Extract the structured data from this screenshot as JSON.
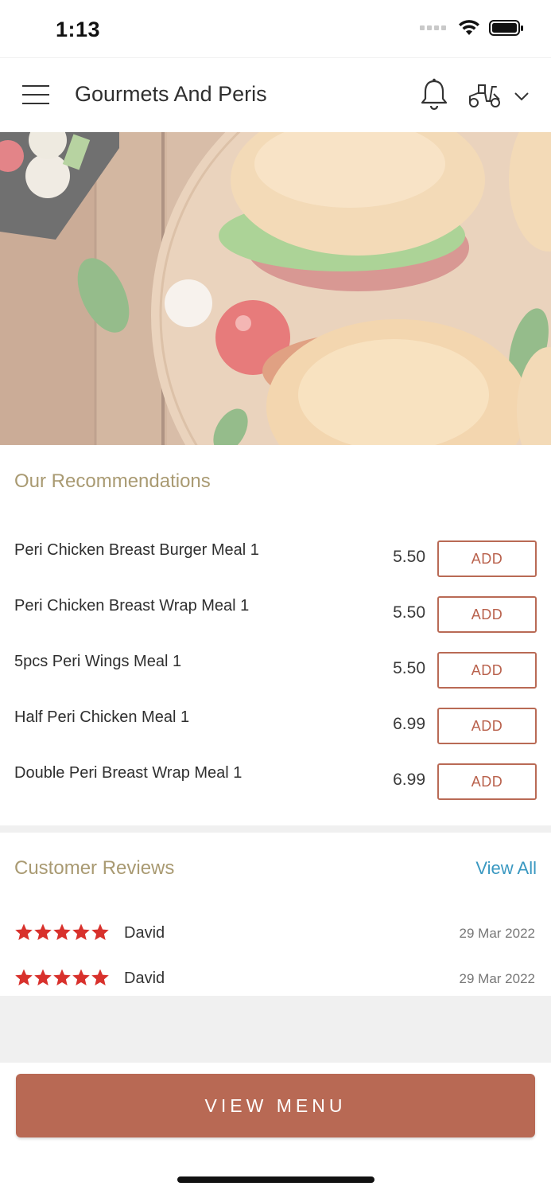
{
  "status_bar": {
    "time": "1:13"
  },
  "header": {
    "title": "Gourmets And Peris"
  },
  "recommendations": {
    "title": "Our Recommendations",
    "items": [
      {
        "name": "Peri Chicken Breast Burger Meal 1",
        "price": "5.50",
        "button": "ADD"
      },
      {
        "name": "Peri Chicken Breast Wrap Meal 1",
        "price": "5.50",
        "button": "ADD"
      },
      {
        "name": "5pcs Peri Wings Meal 1",
        "price": "5.50",
        "button": "ADD"
      },
      {
        "name": "Half Peri Chicken Meal 1",
        "price": "6.99",
        "button": "ADD"
      },
      {
        "name": "Double Peri Breast Wrap Meal 1",
        "price": "6.99",
        "button": "ADD"
      }
    ]
  },
  "reviews": {
    "title": "Customer Reviews",
    "view_all": "View All",
    "items": [
      {
        "name": "David",
        "date": "29 Mar 2022",
        "rating": 5
      },
      {
        "name": "David",
        "date": "29 Mar 2022",
        "rating": 5
      }
    ]
  },
  "footer": {
    "button": "VIEW MENU"
  },
  "colors": {
    "accent": "#b86954",
    "section_title": "#a99a72",
    "link": "#3a98c1",
    "star": "#d8312c"
  }
}
